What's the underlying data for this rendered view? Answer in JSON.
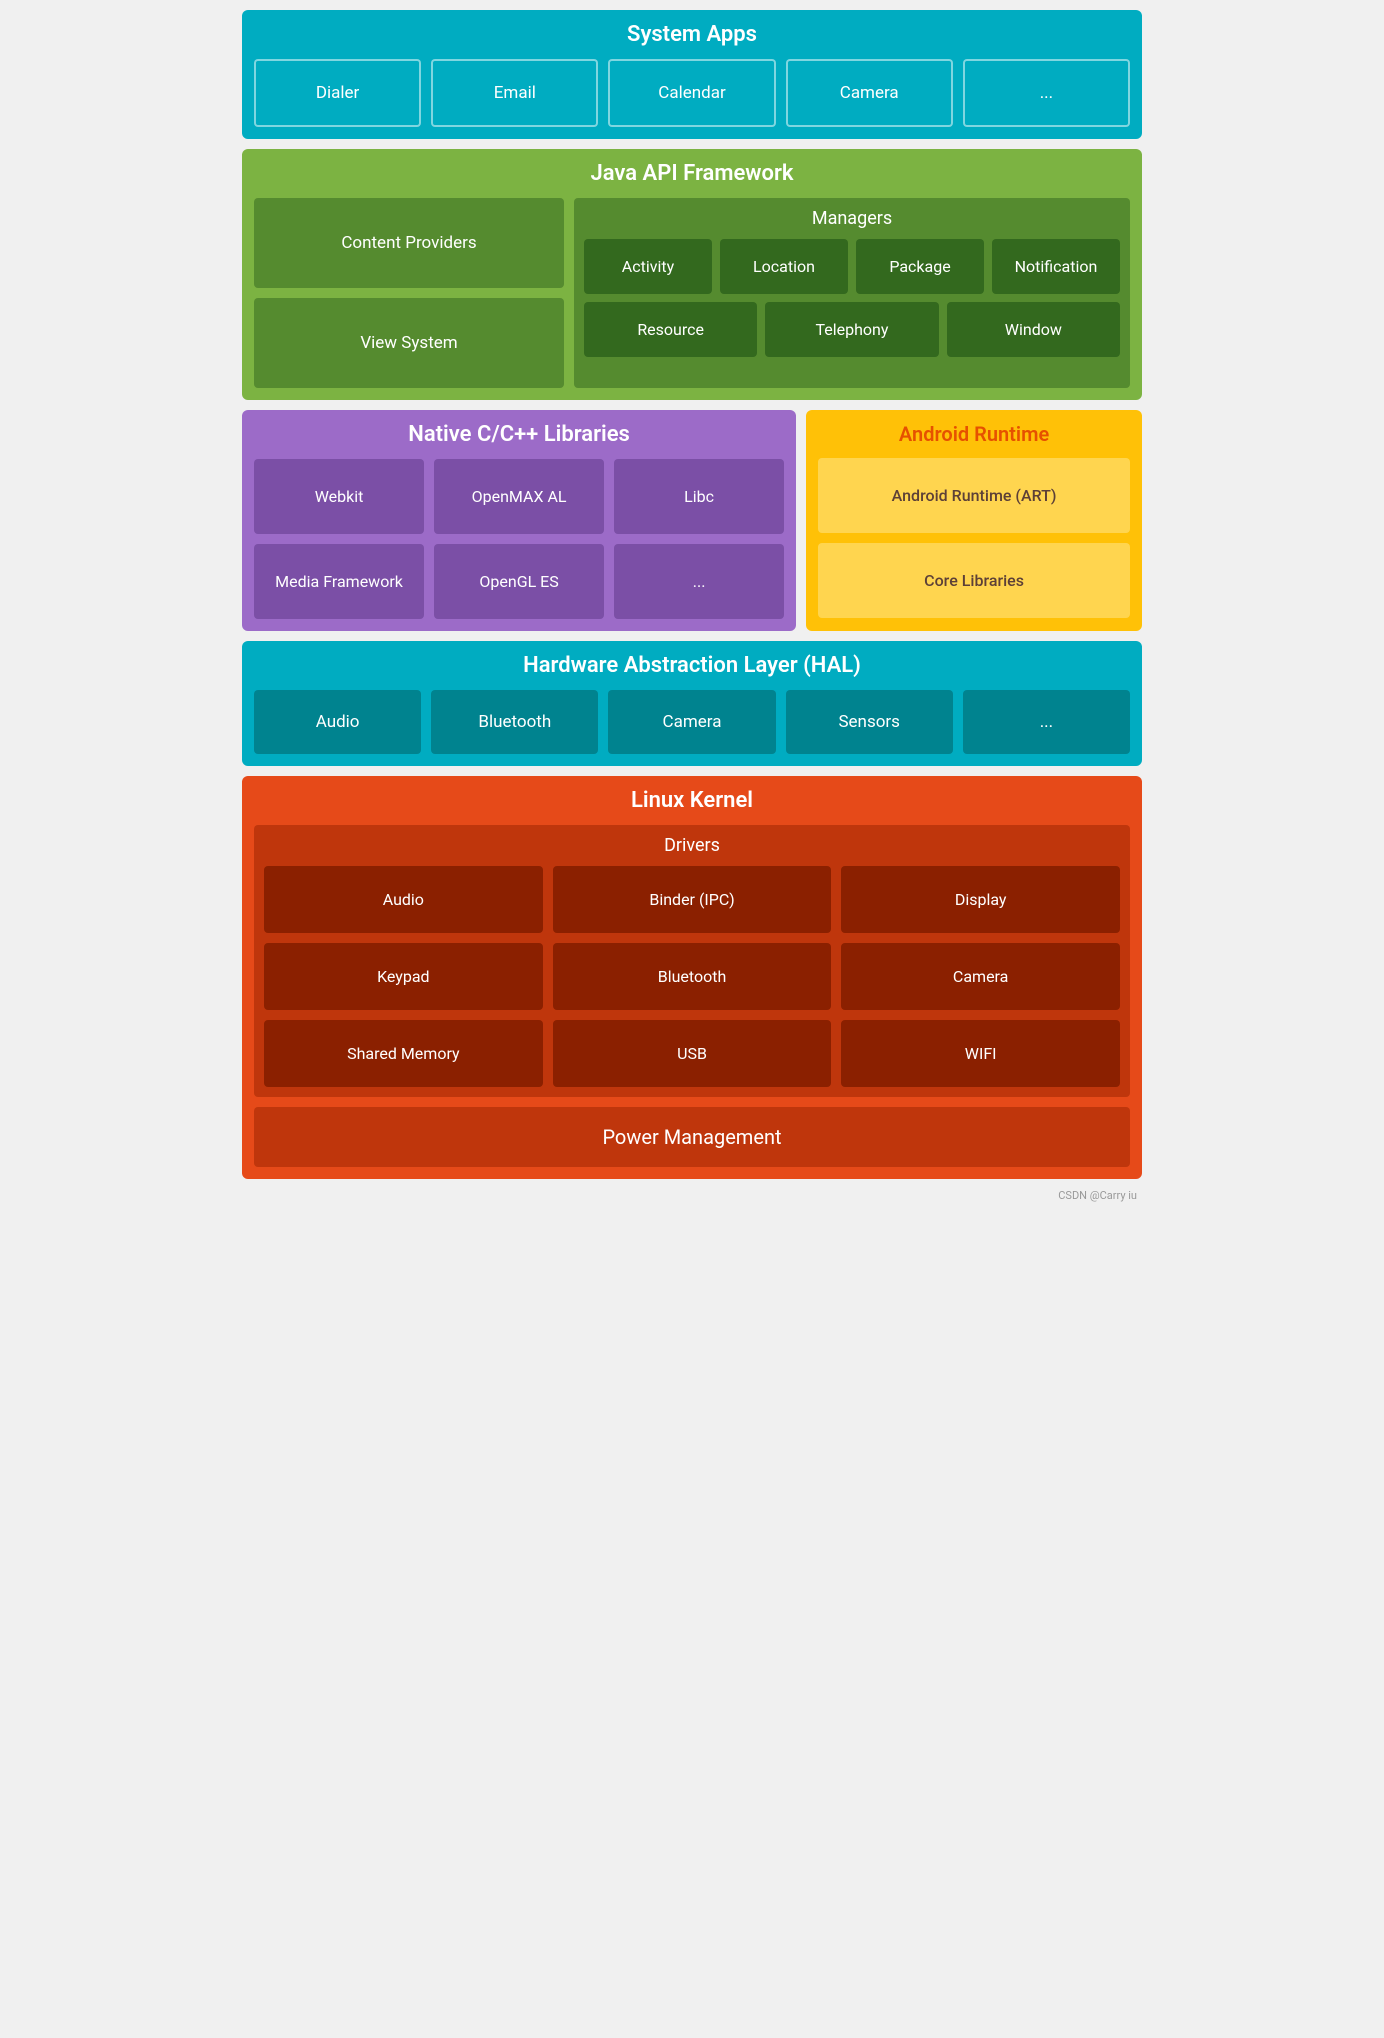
{
  "systemApps": {
    "title": "System Apps",
    "items": [
      "Dialer",
      "Email",
      "Calendar",
      "Camera",
      "..."
    ]
  },
  "javaApi": {
    "title": "Java API Framework",
    "contentProviders": "Content Providers",
    "viewSystem": "View System",
    "managers": {
      "title": "Managers",
      "row1": [
        "Activity",
        "Location",
        "Package",
        "Notification"
      ],
      "row2": [
        "Resource",
        "Telephony",
        "Window"
      ]
    }
  },
  "nativeLibs": {
    "title": "Native C/C++ Libraries",
    "items": [
      "Webkit",
      "OpenMAX AL",
      "Libc",
      "Media Framework",
      "OpenGL ES",
      "..."
    ]
  },
  "androidRuntime": {
    "title": "Android Runtime",
    "items": [
      "Android Runtime (ART)",
      "Core Libraries"
    ]
  },
  "hal": {
    "title": "Hardware Abstraction Layer (HAL)",
    "items": [
      "Audio",
      "Bluetooth",
      "Camera",
      "Sensors",
      "..."
    ]
  },
  "linuxKernel": {
    "title": "Linux Kernel",
    "driversTitle": "Drivers",
    "drivers": [
      "Audio",
      "Binder (IPC)",
      "Display",
      "Keypad",
      "Bluetooth",
      "Camera",
      "Shared Memory",
      "USB",
      "WIFI"
    ],
    "powerManagement": "Power Management"
  },
  "watermark": "CSDN @Carry iu"
}
